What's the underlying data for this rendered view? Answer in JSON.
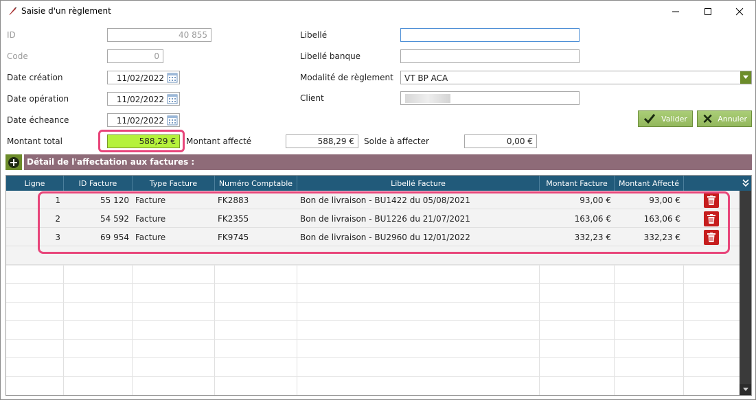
{
  "window": {
    "title": "Saisie d'un règlement"
  },
  "form": {
    "id": {
      "label": "ID",
      "value": "40 855"
    },
    "code": {
      "label": "Code",
      "value": "0"
    },
    "date_creation": {
      "label": "Date création",
      "value": "11/02/2022"
    },
    "date_operation": {
      "label": "Date opération",
      "value": "11/02/2022"
    },
    "date_echeance": {
      "label": "Date écheance",
      "value": "11/02/2022"
    },
    "montant_total": {
      "label": "Montant total",
      "value": "588,29 €"
    },
    "montant_affecte": {
      "label": "Montant affecté",
      "value": "588,29 €"
    },
    "solde": {
      "label": "Solde à affecter",
      "value": "0,00 €"
    },
    "libelle": {
      "label": "Libellé",
      "value": ""
    },
    "libelle_banque": {
      "label": "Libellé banque",
      "value": ""
    },
    "modalite": {
      "label": "Modalité de règlement",
      "value": "VT BP ACA"
    },
    "client": {
      "label": "Client",
      "value": ""
    }
  },
  "buttons": {
    "valider": "Valider",
    "annuler": "Annuler"
  },
  "section": {
    "title": "Détail de l'affectation aux factures :"
  },
  "table": {
    "columns": [
      "Ligne",
      "ID Facture",
      "Type Facture",
      "Numéro Comptable",
      "Libellé Facture",
      "Montant Facture",
      "Montant Affecté"
    ],
    "rows": [
      {
        "ligne": "1",
        "id": "55 120",
        "type": "Facture",
        "numero": "FK2883",
        "libelle": "Bon de livraison - BU1422 du 05/08/2021",
        "montant": "93,00 €",
        "affecte": "93,00 €"
      },
      {
        "ligne": "2",
        "id": "54 592",
        "type": "Facture",
        "numero": "FK2355",
        "libelle": "Bon de livraison - BU1226 du 21/07/2021",
        "montant": "163,06 €",
        "affecte": "163,06 €"
      },
      {
        "ligne": "3",
        "id": "69 954",
        "type": "Facture",
        "numero": "FK9745",
        "libelle": "Bon de livraison - BU2960 du 12/01/2022",
        "montant": "332,23 €",
        "affecte": "332,23 €"
      }
    ]
  },
  "colors": {
    "header_blue": "#215a7a",
    "section_mauve": "#8e6b78",
    "highlight_pink": "#e8457a",
    "total_green": "#b5f23c",
    "delete_red": "#c61d1d"
  }
}
